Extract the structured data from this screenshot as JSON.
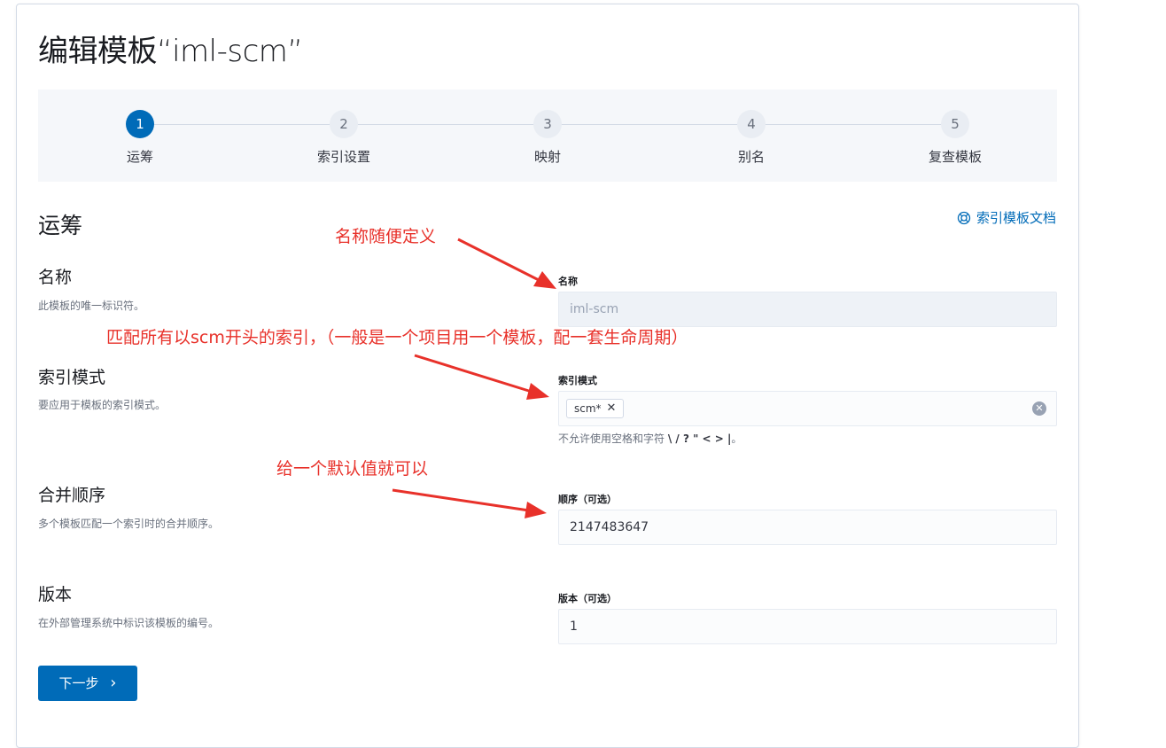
{
  "page": {
    "title": "编辑模板“iml-scm”"
  },
  "steps": [
    {
      "num": "1",
      "label": "运筹"
    },
    {
      "num": "2",
      "label": "索引设置"
    },
    {
      "num": "3",
      "label": "映射"
    },
    {
      "num": "4",
      "label": "别名"
    },
    {
      "num": "5",
      "label": "复查模板"
    }
  ],
  "section": {
    "title": "运筹",
    "doc_link": "索引模板文档"
  },
  "fields": {
    "name": {
      "title": "名称",
      "desc": "此模板的唯一标识符。",
      "label": "名称",
      "value": "iml-scm"
    },
    "pattern": {
      "title": "索引模式",
      "desc": "要应用于模板的索引模式。",
      "label": "索引模式",
      "pill": "scm*",
      "pill_remove": "✕",
      "clear": "✕",
      "help_prefix": "不允许使用空格和字符 ",
      "help_chars": "\\ / ? \" < > |",
      "help_suffix": "。"
    },
    "order": {
      "title": "合并顺序",
      "desc": "多个模板匹配一个索引时的合并顺序。",
      "label": "顺序（可选）",
      "value": "2147483647"
    },
    "version": {
      "title": "版本",
      "desc": "在外部管理系统中标识该模板的编号。",
      "label": "版本（可选）",
      "value": "1"
    }
  },
  "buttons": {
    "next": "下一步",
    "next_chevron": "›"
  },
  "annotations": {
    "name": "名称随便定义",
    "pattern": "匹配所有以scm开头的索引，（一般是一个项目用一个模板，配一套生命周期）",
    "order": "给一个默认值就可以"
  },
  "colors": {
    "accent": "#006bb8",
    "annotation": "#e8312a"
  }
}
